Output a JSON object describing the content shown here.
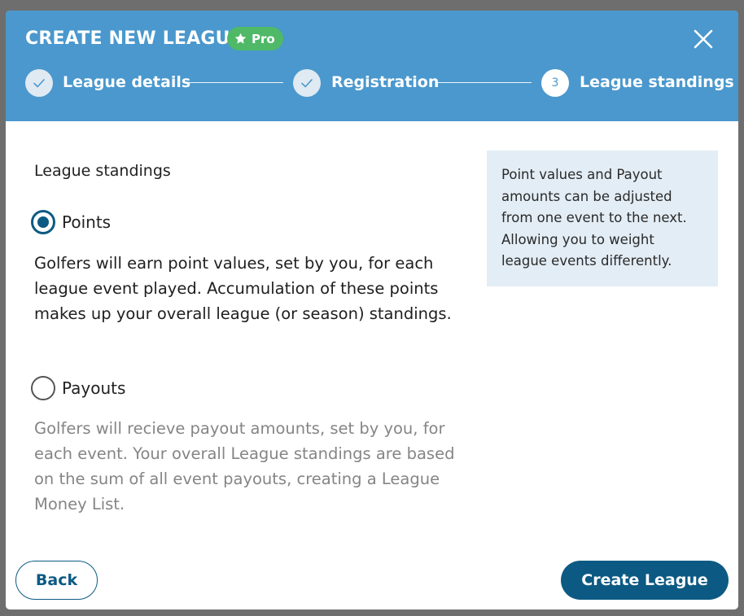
{
  "header": {
    "title": "CREATE NEW LEAGUE",
    "badge": "Pro",
    "steps": [
      {
        "label": "League details",
        "state": "completed"
      },
      {
        "label": "Registration",
        "state": "completed"
      },
      {
        "label": "League standings",
        "number": "3",
        "state": "current"
      }
    ]
  },
  "main": {
    "section_title": "League standings",
    "options": [
      {
        "label": "Points",
        "selected": true,
        "description": "Golfers will earn point values, set by you, for each league event played. Accumulation of these points makes up your overall league (or season) standings."
      },
      {
        "label": "Payouts",
        "selected": false,
        "description": "Golfers will recieve payout amounts, set by you, for each event. Your overall League standings are based on the sum of all event payouts, creating a League Money List."
      }
    ],
    "info": "Point values and Payout amounts can be adjusted from one event to the next. Allowing you to weight league events differently."
  },
  "footer": {
    "back_label": "Back",
    "create_label": "Create League"
  },
  "colors": {
    "header_bg": "#4a98cd",
    "primary": "#0c5a83",
    "badge_bg": "#4fb968",
    "info_bg": "#e3edf5"
  },
  "icons": [
    "star-icon",
    "close-icon",
    "check-icon"
  ]
}
